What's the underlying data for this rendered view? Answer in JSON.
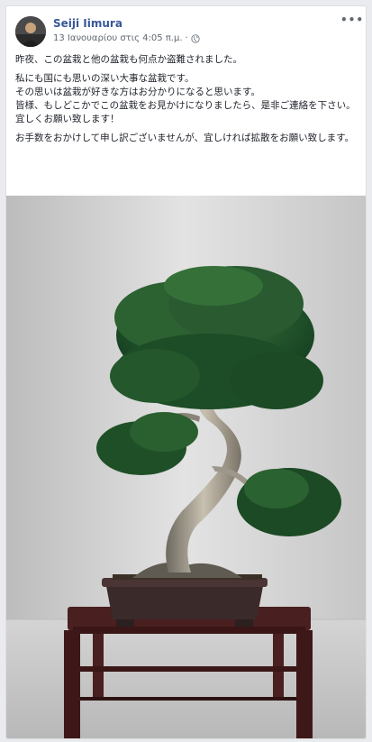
{
  "post": {
    "author": "Seiji Iimura",
    "timestamp": "13 Ιανουαρίου στις 4:05 π.μ.",
    "separator": "·",
    "privacy_icon": "globe-icon",
    "more_icon": "ellipsis-icon",
    "more_label": "•••",
    "paragraphs": [
      "昨夜、この盆栽と他の盆栽も何点か盗難されました。",
      "私にも国にも思いの深い大事な盆栽です。\nその思いは盆栽が好きな方はお分かりになると思います。\n皆様、もしどこかでこの盆栽をお見かけになりましたら、是非ご連絡を下さい。\n宜しくお願い致します！",
      "お手数をおかけして申し訳ございませんが、宜しければ拡散をお願い致します。"
    ],
    "photo_subject": "bonsai tree on wooden display stand"
  },
  "colors": {
    "author_link": "#385898",
    "meta_gray": "#616770",
    "text": "#1d2129",
    "feed_bg": "#e9ebee"
  }
}
